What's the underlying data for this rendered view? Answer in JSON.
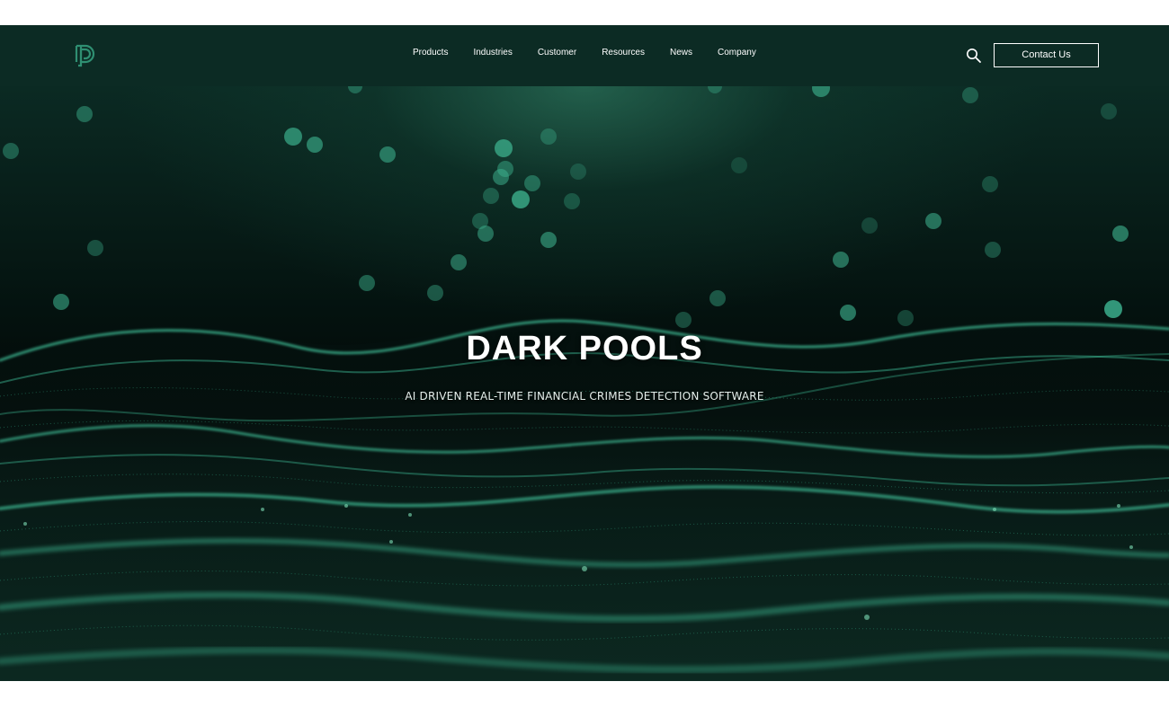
{
  "nav": {
    "logo_alt": "DP",
    "items": [
      {
        "label": "Products"
      },
      {
        "label": "Industries"
      },
      {
        "label": "Customer"
      },
      {
        "label": "Resources"
      },
      {
        "label": "News"
      },
      {
        "label": "Company"
      }
    ],
    "search_icon": "search-icon",
    "contact_label": "Contact Us"
  },
  "hero": {
    "title": "DARK POOLS",
    "subtitle": "AI DRIVEN REAL-TIME FINANCIAL CRIMES DETECTION SOFTWARE",
    "background": "particle-wave-landscape"
  },
  "colors": {
    "nav_bg": "#0c2b24",
    "accent": "#2f8f72",
    "text": "#ffffff"
  }
}
